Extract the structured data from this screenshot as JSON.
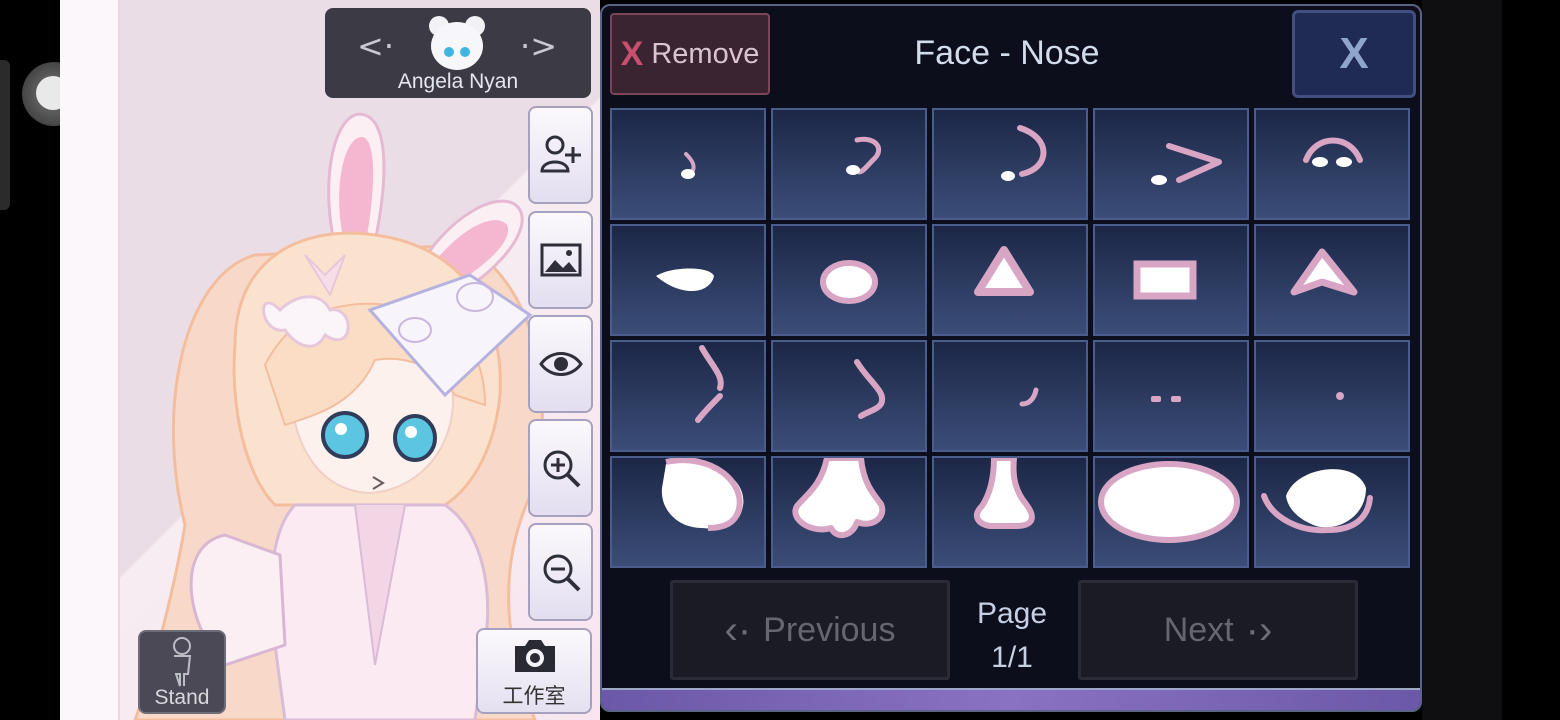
{
  "character_selector": {
    "name": "Angela Nyan",
    "prev_arrow": "<·",
    "next_arrow": "·>"
  },
  "tools": [
    {
      "icon": "add-user-icon"
    },
    {
      "icon": "background-image-icon"
    },
    {
      "icon": "eye-icon"
    },
    {
      "icon": "zoom-in-icon"
    },
    {
      "icon": "zoom-out-icon"
    }
  ],
  "stand_button": {
    "label": "Stand"
  },
  "studio_button": {
    "label": "工作室"
  },
  "panel": {
    "title": "Face - Nose",
    "remove_x": "X",
    "remove_label": "Remove",
    "close_label": "X",
    "previous_label": "Previous",
    "next_label": "Next",
    "page_word": "Page",
    "page_value": "1/1"
  },
  "colors": {
    "nose_stroke": "#d8a6c4",
    "cell_top": "#1c2746",
    "cell_bottom": "#3b4d78",
    "panel_bg": "#0d0e1c"
  },
  "nose_options_count": 20
}
